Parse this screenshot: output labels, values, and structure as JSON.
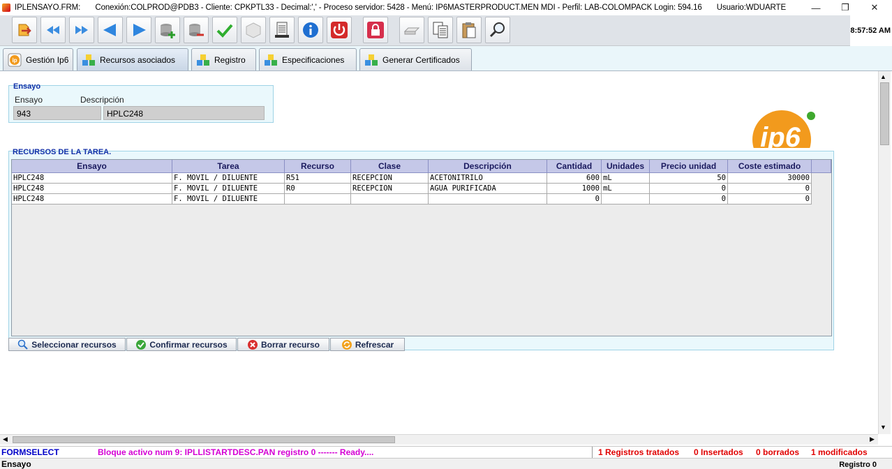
{
  "window": {
    "title_parts": [
      "IPLENSAYO.FRM:",
      "Conexión:COLPROD@PDB3 - Cliente: CPKPTL33 - Decimal:',' - Proceso servidor: 5428 - Menú: IP6MASTERPRODUCT.MEN MDI - Perfil: LAB-COLOMPACK Login: 594.16",
      "Usuario:WDUARTE"
    ],
    "minimize": "—",
    "restore": "❐",
    "close": "✕"
  },
  "toolbar": {
    "clock": "8:57:52 AM",
    "buttons": [
      "exit-icon",
      "first-record-icon",
      "last-record-icon",
      "previous-icon",
      "next-icon",
      "add-record-icon",
      "delete-record-icon",
      "confirm-icon",
      "clear-icon",
      "print-icon",
      "info-icon",
      "power-icon",
      "lock-icon",
      "erase-icon",
      "copy-icon",
      "paste-icon",
      "search-icon"
    ]
  },
  "tabs": [
    {
      "label": "Gestión Ip6",
      "icon": "ip6-logo-icon"
    },
    {
      "label": "Recursos asociados",
      "icon": "cubes-icon"
    },
    {
      "label": "Registro",
      "icon": "cubes-icon"
    },
    {
      "label": "Especificaciones",
      "icon": "cubes-icon"
    },
    {
      "label": "Generar Certificados",
      "icon": "cubes-icon"
    }
  ],
  "ensayo_group": {
    "legend": "Ensayo",
    "ensayo_label": "Ensayo",
    "descripcion_label": "Descripción",
    "ensayo_value": "943",
    "descripcion_value": "HPLC248"
  },
  "recursos": {
    "legend": "RECURSOS DE LA TAREA.",
    "columns": [
      "Ensayo",
      "Tarea",
      "Recurso",
      "Clase",
      "Descripción",
      "Cantidad",
      "Unidades",
      "Precio unidad",
      "Coste estimado"
    ],
    "rows": [
      [
        "HPLC248",
        "F. MOVIL / DILUENTE",
        "R51",
        "RECEPCION",
        "ACETONITRILO",
        "600",
        "mL",
        "50",
        "30000"
      ],
      [
        "HPLC248",
        "F. MOVIL / DILUENTE",
        "R0",
        "RECEPCION",
        "AGUA PURIFICADA",
        "1000",
        "mL",
        "0",
        "0"
      ],
      [
        "HPLC248",
        "F. MOVIL / DILUENTE",
        "",
        "",
        "",
        "0",
        "",
        "0",
        "0"
      ]
    ]
  },
  "actions": {
    "select": "Seleccionar recursos",
    "confirm": "Confirmar recursos",
    "delete": "Borrar recurso",
    "refresh": "Refrescar"
  },
  "logo_text": "ip6",
  "status": {
    "form": "FORMSELECT",
    "bloque": "Bloque activo num 9: IPLLISTARTDESC.PAN  registro 0 ------- Ready....",
    "tratados": "1 Registros tratados",
    "insertados": "0 Insertados",
    "borrados": "0 borrados",
    "modificados": "1 modificados",
    "field": "Ensayo",
    "registro": "Registro 0"
  },
  "colors": {
    "accent_blue": "#1230a8",
    "status_magenta": "#d400d4",
    "status_red": "#e00000",
    "form_blue": "#0000c8",
    "grid_header": "#c5c8e8"
  }
}
